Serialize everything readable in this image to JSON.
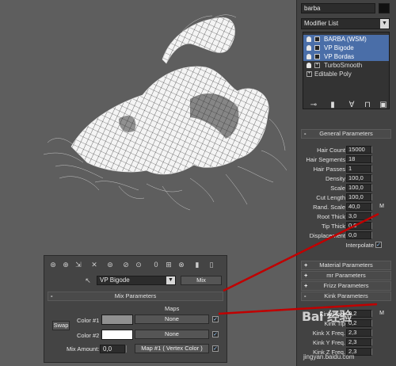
{
  "object_name": "barba",
  "modifier_list_label": "Modifier List",
  "stack": [
    {
      "label": "BARBA (WSM)",
      "selected": true,
      "kind": "modifier"
    },
    {
      "label": "VP Bigode",
      "selected": true,
      "kind": "modifier"
    },
    {
      "label": "VP Bordas",
      "selected": true,
      "kind": "modifier"
    },
    {
      "label": "TurboSmooth",
      "selected": false,
      "kind": "modifier"
    },
    {
      "label": "Editable Poly",
      "selected": false,
      "kind": "base"
    }
  ],
  "stack_tools": [
    "pin-stack-icon",
    "show-end-result-icon",
    "make-unique-icon",
    "remove-modifier-icon",
    "configure-sets-icon"
  ],
  "general_parameters": {
    "title": "General Parameters",
    "rows": [
      {
        "label": "Hair Count",
        "value": "15000"
      },
      {
        "label": "Hair Segments",
        "value": "18"
      },
      {
        "label": "Hair Passes",
        "value": "1"
      },
      {
        "label": "Density",
        "value": "100,0"
      },
      {
        "label": "Scale",
        "value": "100,0"
      },
      {
        "label": "Cut Length",
        "value": "100,0"
      },
      {
        "label": "Rand. Scale",
        "value": "40,0",
        "m": "M"
      },
      {
        "label": "Root Thick",
        "value": "3,0"
      },
      {
        "label": "Tip Thick",
        "value": "0,0"
      },
      {
        "label": "Displacement",
        "value": "0,0"
      }
    ],
    "interpolate_label": "Interpolate",
    "interpolate_checked": true
  },
  "collapsed_rollouts": [
    "Material Parameters",
    "mr Parameters",
    "Frizz Parameters"
  ],
  "kink_parameters": {
    "title": "Kink Parameters",
    "rows": [
      {
        "label": "Kink Root",
        "value": "0,2",
        "m": "M"
      },
      {
        "label": "Kink Tip",
        "value": "0,2"
      },
      {
        "label": "Kink X Freq.",
        "value": "2,3"
      },
      {
        "label": "Kink Y Freq.",
        "value": "2,3"
      },
      {
        "label": "Kink Z Freq.",
        "value": "2,3"
      }
    ]
  },
  "material_window": {
    "material_name": "VP Bigode",
    "material_type_button": "Mix",
    "rollout_title": "Mix Parameters",
    "maps_header": "Maps",
    "swap_label": "Swap",
    "color1_label": "Color #1",
    "color1_hex": "#909090",
    "color1_map": "None",
    "color2_label": "Color #2",
    "color2_hex": "#ffffff",
    "color2_map": "None",
    "mix_amount_label": "Mix Amount:",
    "mix_amount_value": "0,0",
    "mix_map": "Map #1  ( Vertex Color )",
    "toolbar_icons": [
      "get-material-icon",
      "put-to-scene-icon",
      "assign-material-icon",
      "reset-map-icon",
      "make-copy-icon",
      "make-unique-icon",
      "put-to-library-icon",
      "material-id-icon",
      "show-map-icon",
      "show-end-result-icon",
      "go-to-parent-icon",
      "go-forward-icon"
    ]
  },
  "watermark_text": "Bai 经验",
  "watermark_url": "jingyan.baidu.com",
  "colors": {
    "annotation": "#c00000",
    "selection": "#4a6ea8",
    "panel_bg": "#424242",
    "viewport_bg": "#5e5e5e"
  }
}
